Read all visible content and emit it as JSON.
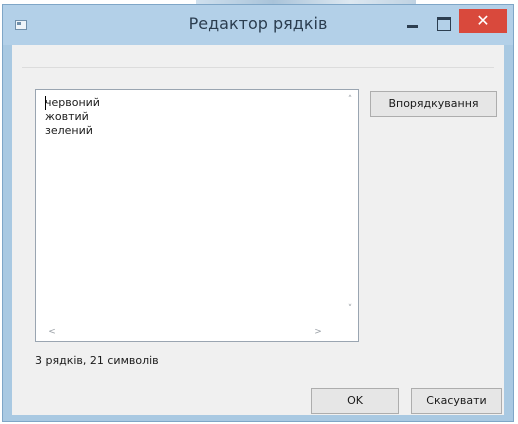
{
  "window": {
    "title": "Редактор рядків",
    "controls": {
      "minimize_icon": "minimize-icon",
      "maximize_icon": "maximize-icon",
      "close_glyph": "✕"
    }
  },
  "editor": {
    "lines": [
      "червоний",
      "жовтий",
      "зелений"
    ],
    "scroll_up": "˄",
    "scroll_down": "˅",
    "scroll_left": "<",
    "scroll_right": ">"
  },
  "buttons": {
    "sort_label": "Впорядкування",
    "ok_label": "OK",
    "cancel_label": "Скасувати"
  },
  "status": {
    "text": "3 рядків, 21 символів"
  },
  "colors": {
    "title_bar": "#b3d0e8",
    "close_button": "#d9493c",
    "client_bg": "#f0f0f0"
  }
}
